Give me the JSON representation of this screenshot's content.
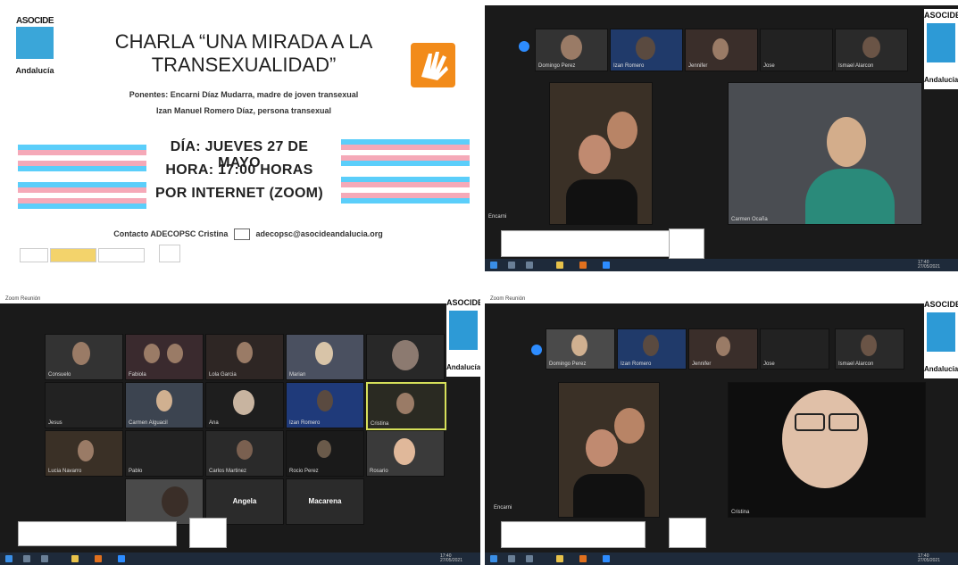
{
  "poster": {
    "logo_top": "ASOCIDE",
    "logo_bottom": "Andalucía",
    "title_line1": "CHARLA “UNA MIRADA A LA",
    "title_line2": "TRANSEXUALIDAD”",
    "speakers_line1": "Ponentes: Encarni Díaz Mudarra, madre de joven transexual",
    "speakers_line2": "Izan Manuel Romero Díaz, persona transexual",
    "day": "DÍA: JUEVES 27 DE MAYO",
    "time": "HORA: 17:00 HORAS",
    "place": "POR INTERNET (ZOOM)",
    "contact_label": "Contacto ADECOPSC Cristina",
    "contact_email": "adecopsc@asocideandalucia.org",
    "flag_colors": [
      "#5bcefa",
      "#f5a9b8",
      "#ffffff",
      "#f5a9b8",
      "#5bcefa"
    ],
    "accent_color": "#f28b1a"
  },
  "side_logo": {
    "top": "ASOCIDE",
    "bottom": "Andalucía"
  },
  "zoom_title": "Zoom Reunión",
  "panel_tr": {
    "thumbnails": [
      "Domingo Perez",
      "Izan Romero",
      "Jennifer",
      "Jose",
      "Ismael Alarcon"
    ],
    "speaker_left_name": "Encarni",
    "speaker_right_name": "Carmen Ocaña"
  },
  "panel_bl": {
    "tiles": [
      "Consuelo",
      "Fabiola",
      "Lola Garcia",
      "Marian",
      "",
      "Jesus",
      "Carmen Alguacil",
      "Ana",
      "Izan Romero",
      "Cristina",
      "Lucia Navarro",
      "Pablo",
      "Carlos Martinez",
      "Rocio Perez",
      "Rosario",
      "",
      "Angela",
      "Macarena"
    ],
    "bigname_1": "Angela",
    "bigname_2": "Macarena"
  },
  "panel_br": {
    "thumbnails": [
      "Domingo Perez",
      "Izan Romero",
      "Jennifer",
      "Jose",
      "Ismael Alarcon"
    ],
    "speaker_left_name": "Encarni",
    "speaker_right_name": "Cristina"
  },
  "taskbar_clock": {
    "time": "17:40",
    "date": "27/05/2021"
  }
}
